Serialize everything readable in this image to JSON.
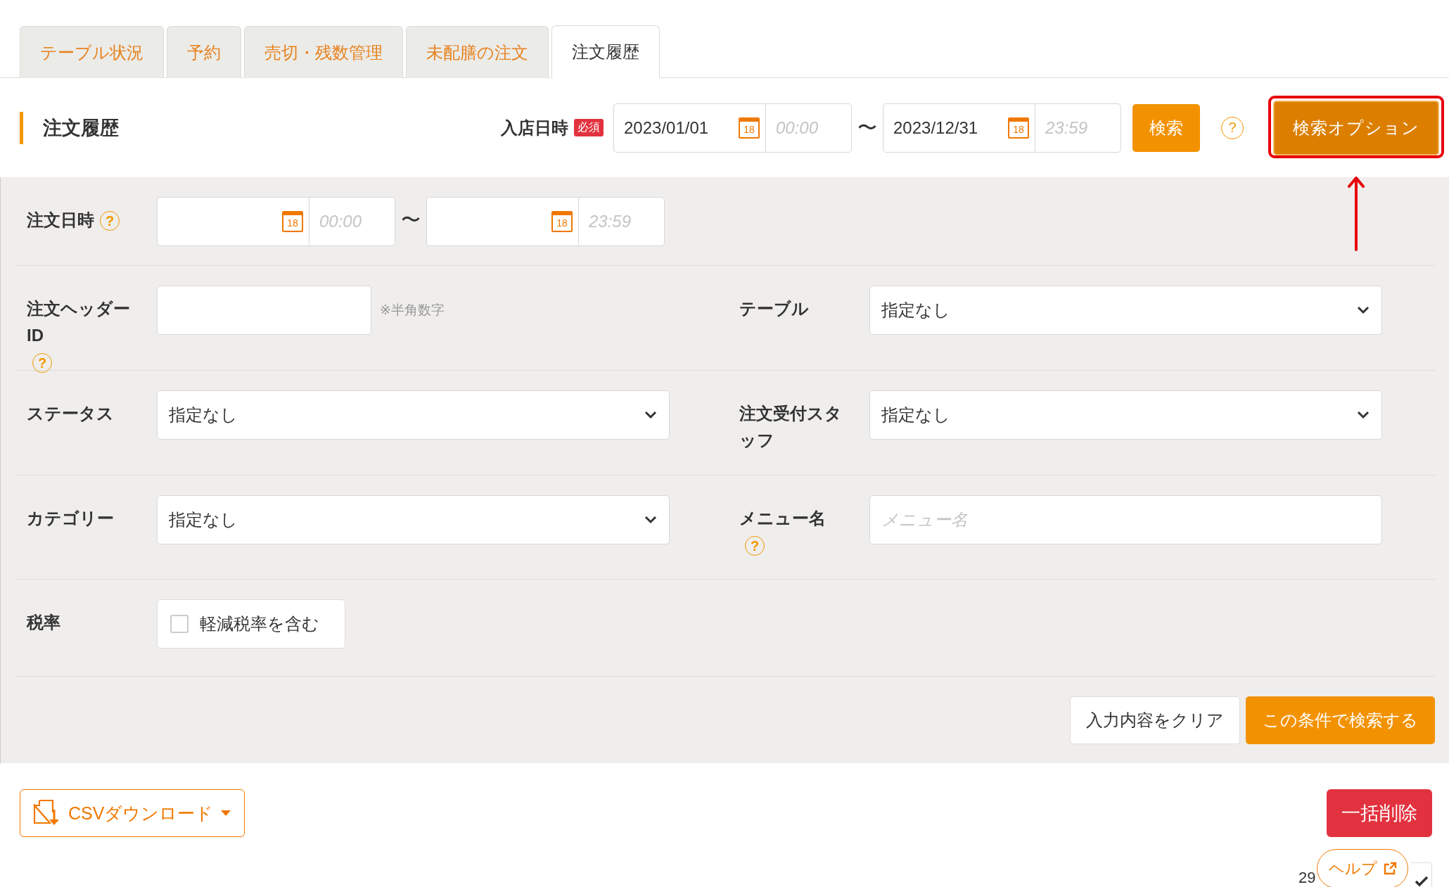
{
  "tabs": [
    {
      "label": "テーブル状況",
      "selected": false
    },
    {
      "label": "予約",
      "selected": false
    },
    {
      "label": "売切・残数管理",
      "selected": false
    },
    {
      "label": "未配膳の注文",
      "selected": false
    },
    {
      "label": "注文履歴",
      "selected": true
    }
  ],
  "header": {
    "title": "注文履歴",
    "entry_label": "入店日時",
    "required_badge": "必須",
    "from": {
      "date": "2023/01/01",
      "calendar_label": "18",
      "time_placeholder": "00:00"
    },
    "separator": "〜",
    "to": {
      "date": "2023/12/31",
      "calendar_label": "18",
      "time_placeholder": "23:59"
    },
    "search_button": "検索",
    "help": "?",
    "options_button": "検索オプション",
    "options_highlighted": true
  },
  "filters": [
    [
      {
        "kind": "daterange",
        "label": "注文日時",
        "help": "?",
        "separator": "〜",
        "from": {
          "calendar_label": "18",
          "time_placeholder": "00:00"
        },
        "to": {
          "calendar_label": "18",
          "time_placeholder": "23:59"
        }
      }
    ],
    [
      {
        "kind": "text",
        "label": "注文ヘッダーID",
        "help": "?",
        "note": "※半角数字"
      },
      {
        "kind": "select",
        "label": "テーブル",
        "value": "指定なし"
      }
    ],
    [
      {
        "kind": "select",
        "label": "ステータス",
        "value": "指定なし"
      },
      {
        "kind": "select",
        "label": "注文受付スタッフ",
        "value": "指定なし"
      }
    ],
    [
      {
        "kind": "select",
        "label": "カテゴリー",
        "value": "指定なし"
      },
      {
        "kind": "text",
        "label": "メニュー名",
        "help": "?",
        "placeholder": "メニュー名"
      }
    ],
    [
      {
        "kind": "checkbox",
        "label": "税率",
        "option": "軽減税率を含む",
        "checked": false
      }
    ]
  ],
  "clear_button": "入力内容をクリア",
  "submit_button": "この条件で検索する",
  "footer": {
    "csv_button": "CSVダウンロード",
    "delete_button": "一括削除",
    "help_button": "ヘルプ",
    "page_size": "29"
  }
}
